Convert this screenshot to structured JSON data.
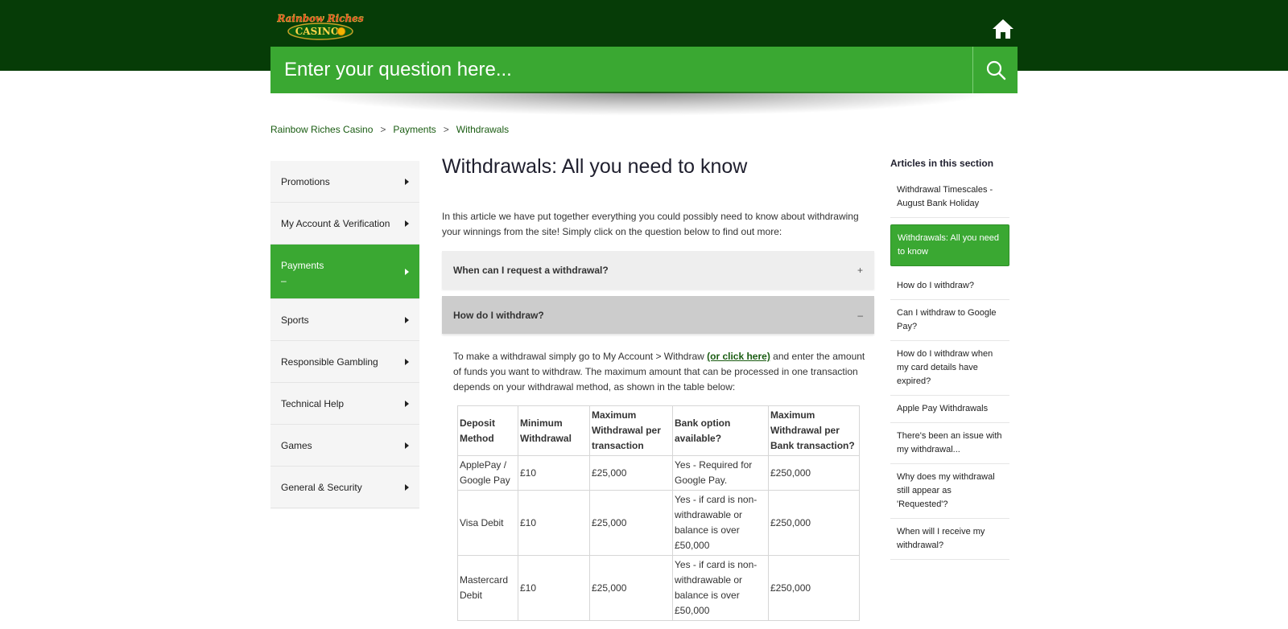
{
  "brand": {
    "logo_top": "Rainbow Riches",
    "logo_bottom": "CASINO",
    "colors": {
      "header": "#063c07",
      "accent": "#3aa832"
    }
  },
  "header": {
    "home_icon": "home-icon"
  },
  "search": {
    "placeholder": "Enter your question here...",
    "icon": "search-icon"
  },
  "breadcrumb": [
    {
      "label": "Rainbow Riches Casino"
    },
    {
      "label": "Payments"
    },
    {
      "label": "Withdrawals"
    }
  ],
  "breadcrumb_sep": ">",
  "sidebar": {
    "items": [
      {
        "label": "Promotions"
      },
      {
        "label": "My Account & Verification"
      },
      {
        "label": "Payments",
        "sub": "–"
      },
      {
        "label": "Sports"
      },
      {
        "label": "Responsible Gambling"
      },
      {
        "label": "Technical Help"
      },
      {
        "label": "Games"
      },
      {
        "label": "General & Security"
      }
    ]
  },
  "article": {
    "title": "Withdrawals: All you need to know",
    "intro": "In this article we have put together everything you could possibly need to know about withdrawing your winnings from the site! Simply click on the question below to find out more:",
    "accordions": [
      {
        "question": "When can I request a withdrawal?",
        "toggle": "+"
      },
      {
        "question": "How do I withdraw?",
        "toggle": "–"
      }
    ],
    "body_pre": "To make a withdrawal simply go to My Account > Withdraw ",
    "body_link": "(or click here)",
    "body_post": " and enter the amount of funds you want to withdraw. The maximum amount that can be processed in one transaction depends on your withdrawal method, as shown in the table below:",
    "table": {
      "headers": [
        "Deposit Method",
        "Minimum Withdrawal",
        "Maximum Withdrawal per transaction",
        "Bank option available?",
        "Maximum Withdrawal per Bank transaction?"
      ],
      "rows": [
        [
          "ApplePay / Google Pay",
          "£10",
          "£25,000",
          "Yes - Required for Google Pay.",
          "£250,000"
        ],
        [
          "Visa Debit",
          "£10",
          "£25,000",
          "Yes - if card is non-withdrawable or balance is over £50,000",
          "£250,000"
        ],
        [
          "Mastercard Debit",
          "£10",
          "£25,000",
          "Yes - if card is non-withdrawable or balance is over £50,000",
          "£250,000"
        ]
      ]
    }
  },
  "right_nav": {
    "title": "Articles in this section",
    "items": [
      {
        "label": "Withdrawal Timescales - August Bank Holiday"
      },
      {
        "label": "Withdrawals: All you need to know"
      },
      {
        "label": "How do I withdraw?"
      },
      {
        "label": "Can I withdraw to Google Pay?"
      },
      {
        "label": "How do I withdraw when my card details have expired?"
      },
      {
        "label": "Apple Pay Withdrawals"
      },
      {
        "label": "There's been an issue with my withdrawal..."
      },
      {
        "label": "Why does my withdrawal still appear as 'Requested'?"
      },
      {
        "label": "When will I receive my withdrawal?"
      }
    ]
  }
}
